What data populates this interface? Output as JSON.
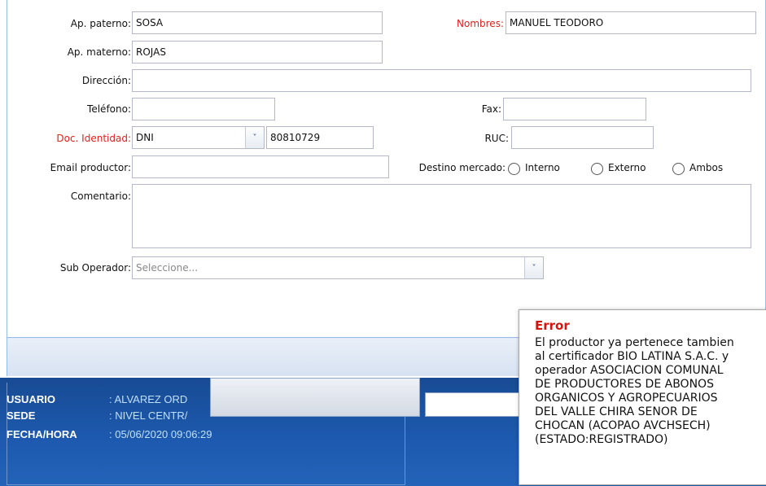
{
  "form": {
    "ap_paterno": {
      "label": "Ap. paterno:",
      "value": "SOSA"
    },
    "nombres": {
      "label": "Nombres:",
      "value": "MANUEL TEODORO"
    },
    "ap_materno": {
      "label": "Ap. materno:",
      "value": "ROJAS"
    },
    "direccion": {
      "label": "Dirección:",
      "value": ""
    },
    "telefono": {
      "label": "Teléfono:",
      "value": ""
    },
    "fax": {
      "label": "Fax:",
      "value": ""
    },
    "doc_identidad": {
      "label": "Doc. Identidad:",
      "type_value": "DNI",
      "number": "80810729"
    },
    "ruc": {
      "label": "RUC:",
      "value": ""
    },
    "email": {
      "label": "Email productor:",
      "value": ""
    },
    "destino": {
      "label": "Destino mercado:",
      "options": [
        "Interno",
        "Externo",
        "Ambos"
      ]
    },
    "comentario": {
      "label": "Comentario:",
      "value": ""
    },
    "sub_operador": {
      "label": "Sub Operador:",
      "placeholder": "Seleccione..."
    }
  },
  "status": {
    "usuario_key": "USUARIO",
    "usuario_val": ": ALVAREZ ORD",
    "sede_key": "SEDE",
    "sede_val": ": NIVEL CENTR/",
    "fecha_key": "FECHA/HORA",
    "fecha_val": ": 05/06/2020 09:06:29"
  },
  "error": {
    "title": "Error",
    "message": "El productor ya pertenece tambien\nal certificador BIO LATINA S.A.C. y\noperador ASOCIACION COMUNAL\nDE PRODUCTORES DE ABONOS\nORGANICOS Y AGROPECUARIOS\nDEL VALLE CHIRA SENOR DE\nCHOCAN (ACOPAO AVCHSECH)\n(ESTADO:REGISTRADO)"
  },
  "colors": {
    "required_label": "#e0201b",
    "error_title": "#d8140e",
    "status_bg": "#1d5ab0",
    "panel_border": "#99bbe8"
  }
}
